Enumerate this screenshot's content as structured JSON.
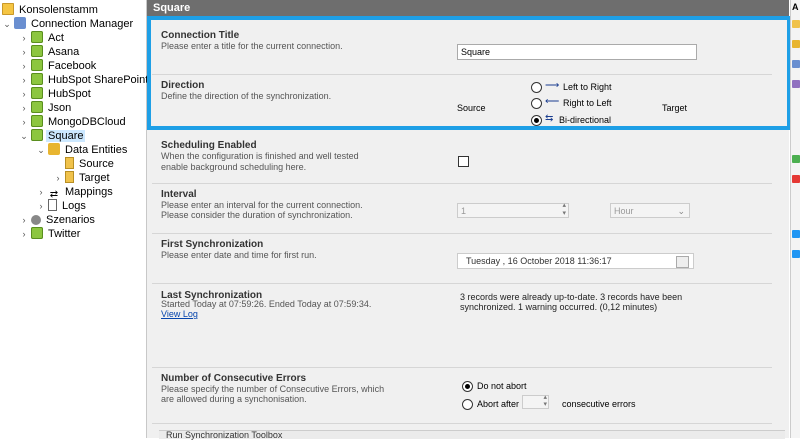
{
  "tree": {
    "items": [
      {
        "label": "Konsolenstamm"
      },
      {
        "label": "Connection Manager"
      },
      {
        "label": "Act"
      },
      {
        "label": "Asana"
      },
      {
        "label": "Facebook"
      },
      {
        "label": "HubSpot SharePoint"
      },
      {
        "label": "HubSpot"
      },
      {
        "label": "Json"
      },
      {
        "label": "MongoDBCloud"
      },
      {
        "label": "Square"
      },
      {
        "label": "Data Entities"
      },
      {
        "label": "Source"
      },
      {
        "label": "Target"
      },
      {
        "label": "Mappings"
      },
      {
        "label": "Logs"
      },
      {
        "label": "Szenarios"
      },
      {
        "label": "Twitter"
      }
    ]
  },
  "header": {
    "title": "Square"
  },
  "connection_title": {
    "title": "Connection Title",
    "desc": "Please enter a title for the current connection.",
    "value": "Square"
  },
  "direction": {
    "title": "Direction",
    "desc": "Define the direction of the synchronization.",
    "source_label": "Source",
    "target_label": "Target",
    "options": [
      "Left to Right",
      "Right to Left",
      "Bi-directional"
    ],
    "arrows": [
      "⟶",
      "⟵",
      "⇆"
    ],
    "selected": "Bi-directional"
  },
  "scheduling": {
    "title": "Scheduling Enabled",
    "desc1": "When the configuration is finished and well tested",
    "desc2": "enable background scheduling here."
  },
  "interval": {
    "title": "Interval",
    "desc1": "Please enter an interval for the current connection.",
    "desc2": "Please consider the duration of synchronization.",
    "value": "1",
    "unit": "Hour"
  },
  "first_sync": {
    "title": "First Synchronization",
    "desc": "Please enter date and time for first run.",
    "value": "Tuesday  , 16  October  2018 11:36:17"
  },
  "last_sync": {
    "title": "Last Synchronization",
    "desc": "Started  Today at 07:59:26. Ended Today at 07:59:34.",
    "link": "View Log",
    "result1": "3 records were already up-to-date. 3 records have been",
    "result2": "synchronized. 1 warning occurred. (0,12 minutes)"
  },
  "errors": {
    "title": "Number of Consecutive Errors",
    "desc1": "Please specify the number of Consecutive Errors, which",
    "desc2": "are allowed during a synchonisation.",
    "opt_no_abort": "Do not abort",
    "opt_abort_after": "Abort after",
    "suffix": "consecutive errors"
  },
  "toolbox": {
    "title": "Run Synchronization Toolbox"
  },
  "colors": {
    "highlight": "#1e9fe6",
    "header": "#6e6e6e",
    "selection": "#cce8ff"
  }
}
